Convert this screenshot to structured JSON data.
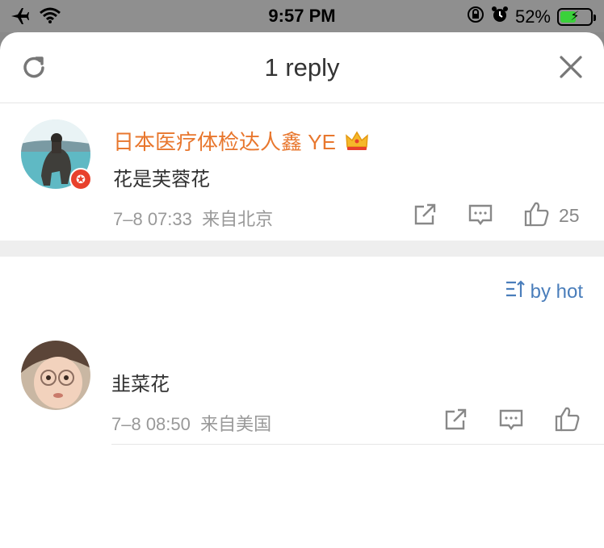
{
  "status_bar": {
    "time": "9:57 PM",
    "battery_percent": "52%",
    "battery_level": 0.52,
    "battery_color": "#3ad13a"
  },
  "header": {
    "title": "1 reply",
    "refresh_icon": "refresh-icon",
    "close_icon": "close-icon"
  },
  "root_comment": {
    "username": "日本医疗体检达人鑫 YE",
    "username_color": "#e8772e",
    "text": "花是芙蓉花",
    "date": "7–8 07:33",
    "location": "来自北京",
    "like_count": "25"
  },
  "sort": {
    "label": "by hot"
  },
  "replies": [
    {
      "text": "韭菜花",
      "date": "7–8 08:50",
      "location": "来自美国"
    }
  ]
}
